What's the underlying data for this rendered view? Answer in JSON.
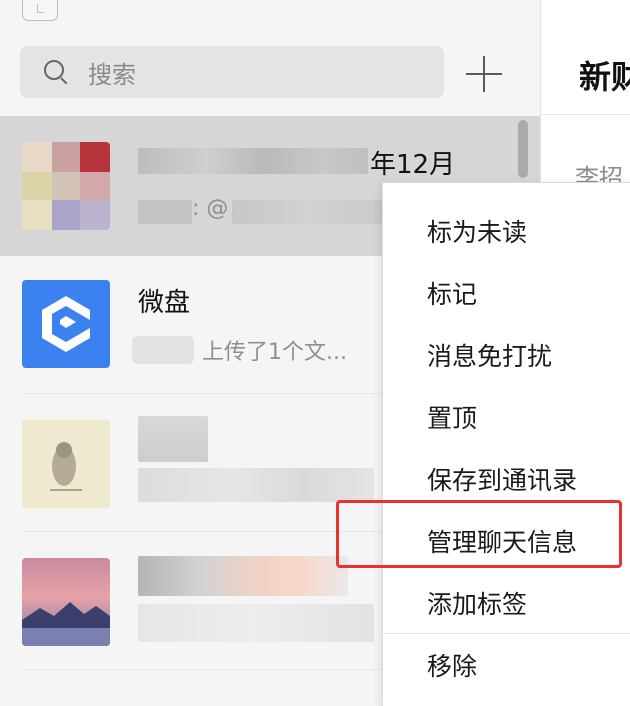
{
  "search": {
    "placeholder": "搜索"
  },
  "right_pane": {
    "title": "新财",
    "subtitle": "李招"
  },
  "chat_list": [
    {
      "title": "年12月",
      "preview": ": @"
    },
    {
      "title": "微盘",
      "preview": "上传了1个文..."
    },
    {
      "title": "",
      "preview": ""
    },
    {
      "title": "",
      "preview": ""
    }
  ],
  "context_menu": {
    "items": [
      "标为未读",
      "标记",
      "消息免打扰",
      "置顶",
      "保存到通讯录",
      "管理聊天信息",
      "添加标签",
      "移除"
    ],
    "highlighted": "管理聊天信息"
  },
  "colors": {
    "highlight": "#e8322f",
    "weipan_brand": "#3b82f0",
    "selected_row": "#d6d6d6"
  }
}
